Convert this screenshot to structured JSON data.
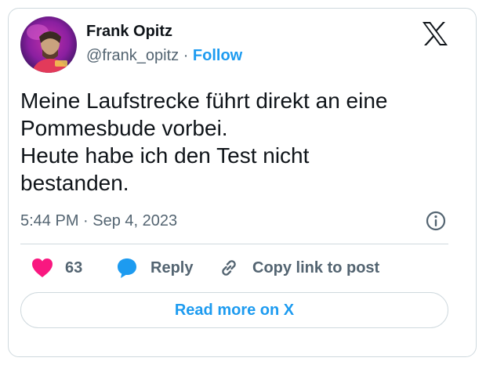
{
  "author": {
    "display_name": "Frank Opitz",
    "handle": "@frank_opitz",
    "separator": " · ",
    "follow_label": "Follow"
  },
  "platform_icon": "x-logo-icon",
  "tweet": {
    "text": "Meine Laufstrecke führt direkt an eine\nPommesbude vorbei.\nHeute habe ich den Test nicht\nbestanden.",
    "timestamp": "5:44 PM · Sep 4, 2023"
  },
  "actions": {
    "like_count": "63",
    "like_icon": "heart-icon",
    "reply_label": "Reply",
    "reply_icon": "speech-bubble-icon",
    "copy_label": "Copy link to post",
    "copy_icon": "link-icon"
  },
  "read_more_label": "Read more on X",
  "colors": {
    "accent": "#1d9bf0",
    "like": "#f91880",
    "text": "#0f1419",
    "muted": "#536471",
    "border": "#cfd9de"
  }
}
